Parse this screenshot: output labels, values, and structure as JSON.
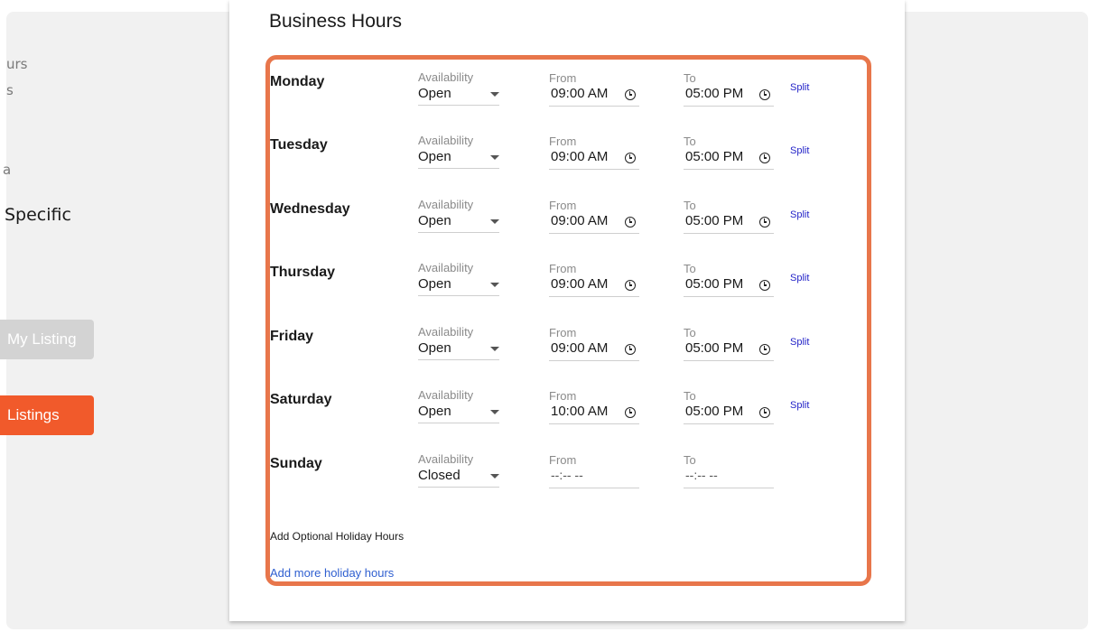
{
  "sidebar": {
    "partial_lines": [
      "urs",
      "s",
      "a"
    ],
    "section_heading": "Specific",
    "buttons": {
      "my_listing": "My Listing",
      "listings": "Listings"
    }
  },
  "card": {
    "title": "Business Hours"
  },
  "field_labels": {
    "availability": "Availability",
    "from": "From",
    "to": "To",
    "split": "Split"
  },
  "days": [
    {
      "name": "Monday",
      "availability": "Open",
      "from": "09:00 AM",
      "to": "05:00 PM"
    },
    {
      "name": "Tuesday",
      "availability": "Open",
      "from": "09:00 AM",
      "to": "05:00 PM"
    },
    {
      "name": "Wednesday",
      "availability": "Open",
      "from": "09:00 AM",
      "to": "05:00 PM"
    },
    {
      "name": "Thursday",
      "availability": "Open",
      "from": "09:00 AM",
      "to": "05:00 PM"
    },
    {
      "name": "Friday",
      "availability": "Open",
      "from": "09:00 AM",
      "to": "05:00 PM"
    },
    {
      "name": "Saturday",
      "availability": "Open",
      "from": "10:00 AM",
      "to": "05:00 PM"
    },
    {
      "name": "Sunday",
      "availability": "Closed",
      "from": "--:-- --",
      "to": "--:-- --"
    }
  ],
  "holiday": {
    "optional_label": "Add Optional Holiday Hours",
    "add_more_link": "Add more holiday hours"
  },
  "colors": {
    "accent_orange": "#f15a2b",
    "highlight_border": "#e8764b",
    "split_link": "#2323c8",
    "add_link": "#2f5fd0"
  }
}
